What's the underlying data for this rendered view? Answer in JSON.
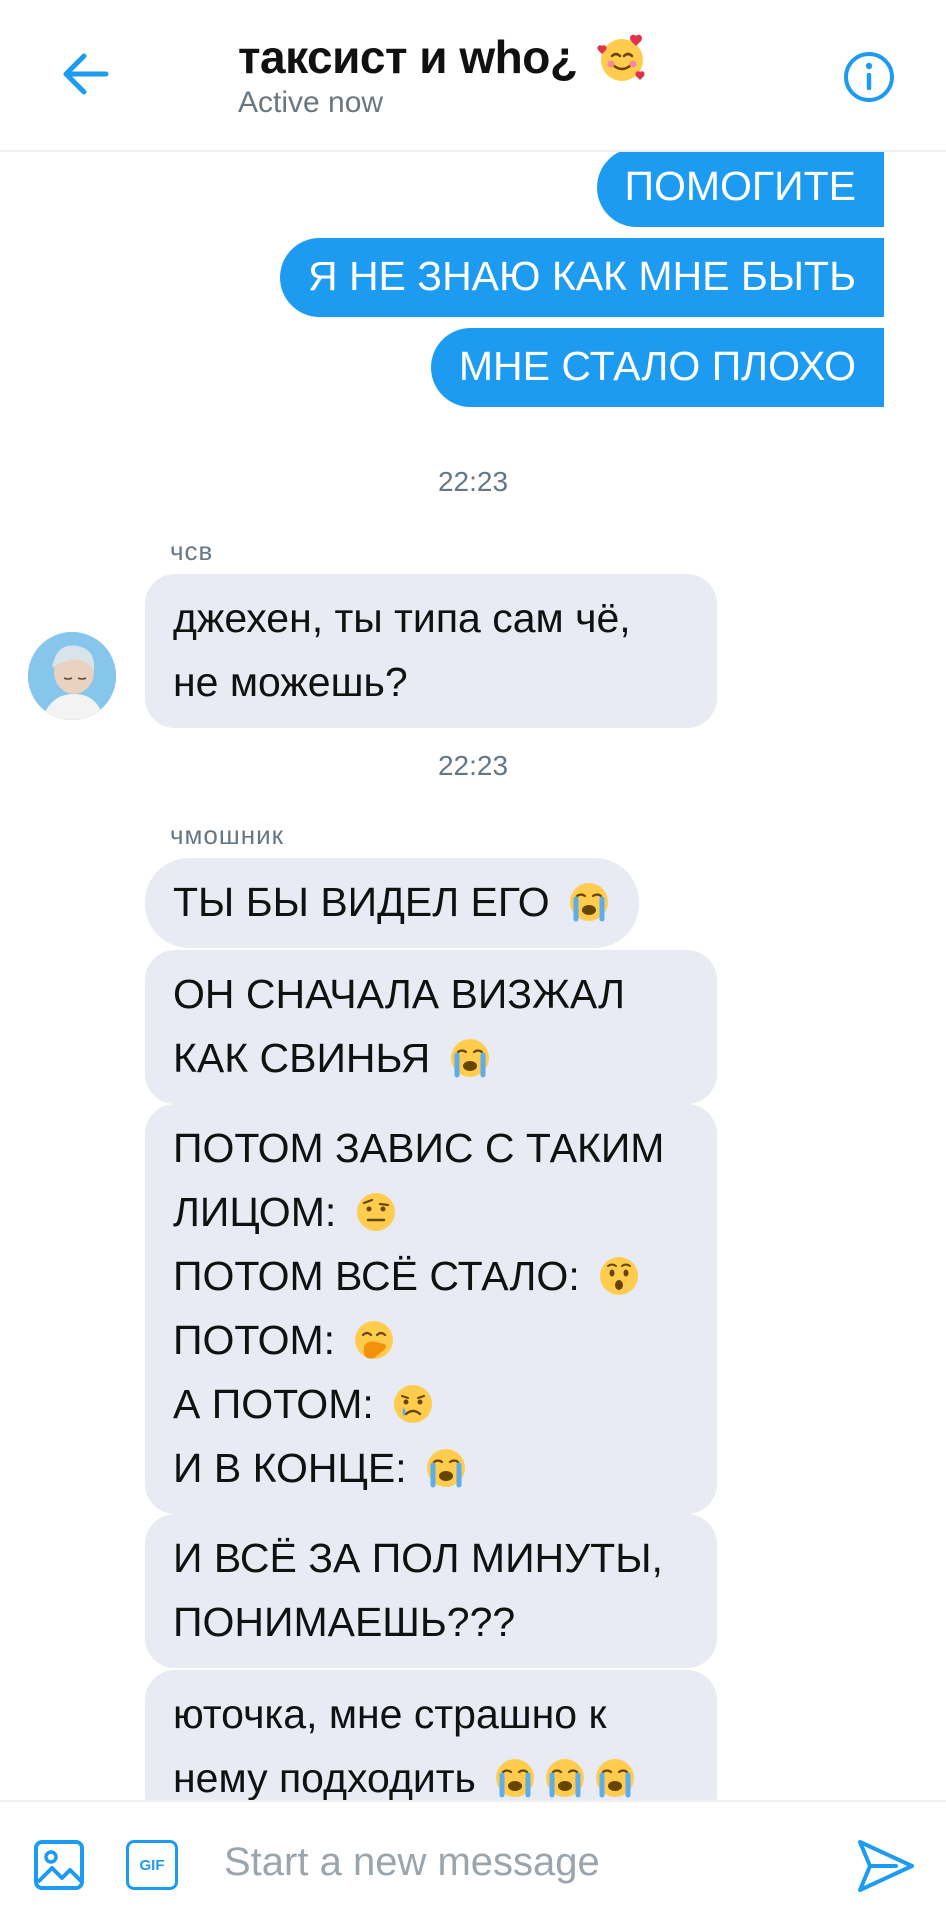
{
  "header": {
    "title": "таксист и who¿",
    "subtitle": "Active now"
  },
  "messages_out": [
    "ПОМОГИТЕ",
    "Я НЕ ЗНАЮ КАК МНЕ БЫТЬ",
    "МНЕ СТАЛО ПЛОХО"
  ],
  "timestamps": [
    "22:23",
    "22:23"
  ],
  "group1": {
    "sender": "чсв",
    "bubble": [
      "джехен, ты типа сам чё,",
      "не можешь?"
    ]
  },
  "group2": {
    "sender": "чмошник",
    "bubbles": [
      [
        "ТЫ БЫ ВИДЕЛ ЕГО"
      ],
      [
        "ОН СНАЧАЛА ВИЗЖАЛ",
        "КАК СВИНЬЯ"
      ],
      [
        "ПОТОМ ЗАВИС С ТАКИМ",
        "ЛИЦОМ:",
        "ПОТОМ ВСЁ СТАЛО:",
        "ПОТОМ:",
        "А ПОТОМ:",
        "И В КОНЦЕ:"
      ],
      [
        "И ВСЁ ЗА ПОЛ МИНУТЫ,",
        "ПОНИМАЕШЬ???"
      ],
      [
        "юточка, мне страшно к",
        "нему подходить"
      ]
    ]
  },
  "composer": {
    "placeholder": "Start a new message",
    "gif_label": "GIF"
  },
  "icons": {
    "back": "arrow-left-icon",
    "info": "info-icon",
    "title_emoji": "smiling-face-with-hearts-emoji",
    "image": "image-icon",
    "gif": "gif-icon",
    "send": "send-icon"
  },
  "colors": {
    "accent": "#1d9bf0",
    "incoming_bubble": "#e8ebf3"
  }
}
